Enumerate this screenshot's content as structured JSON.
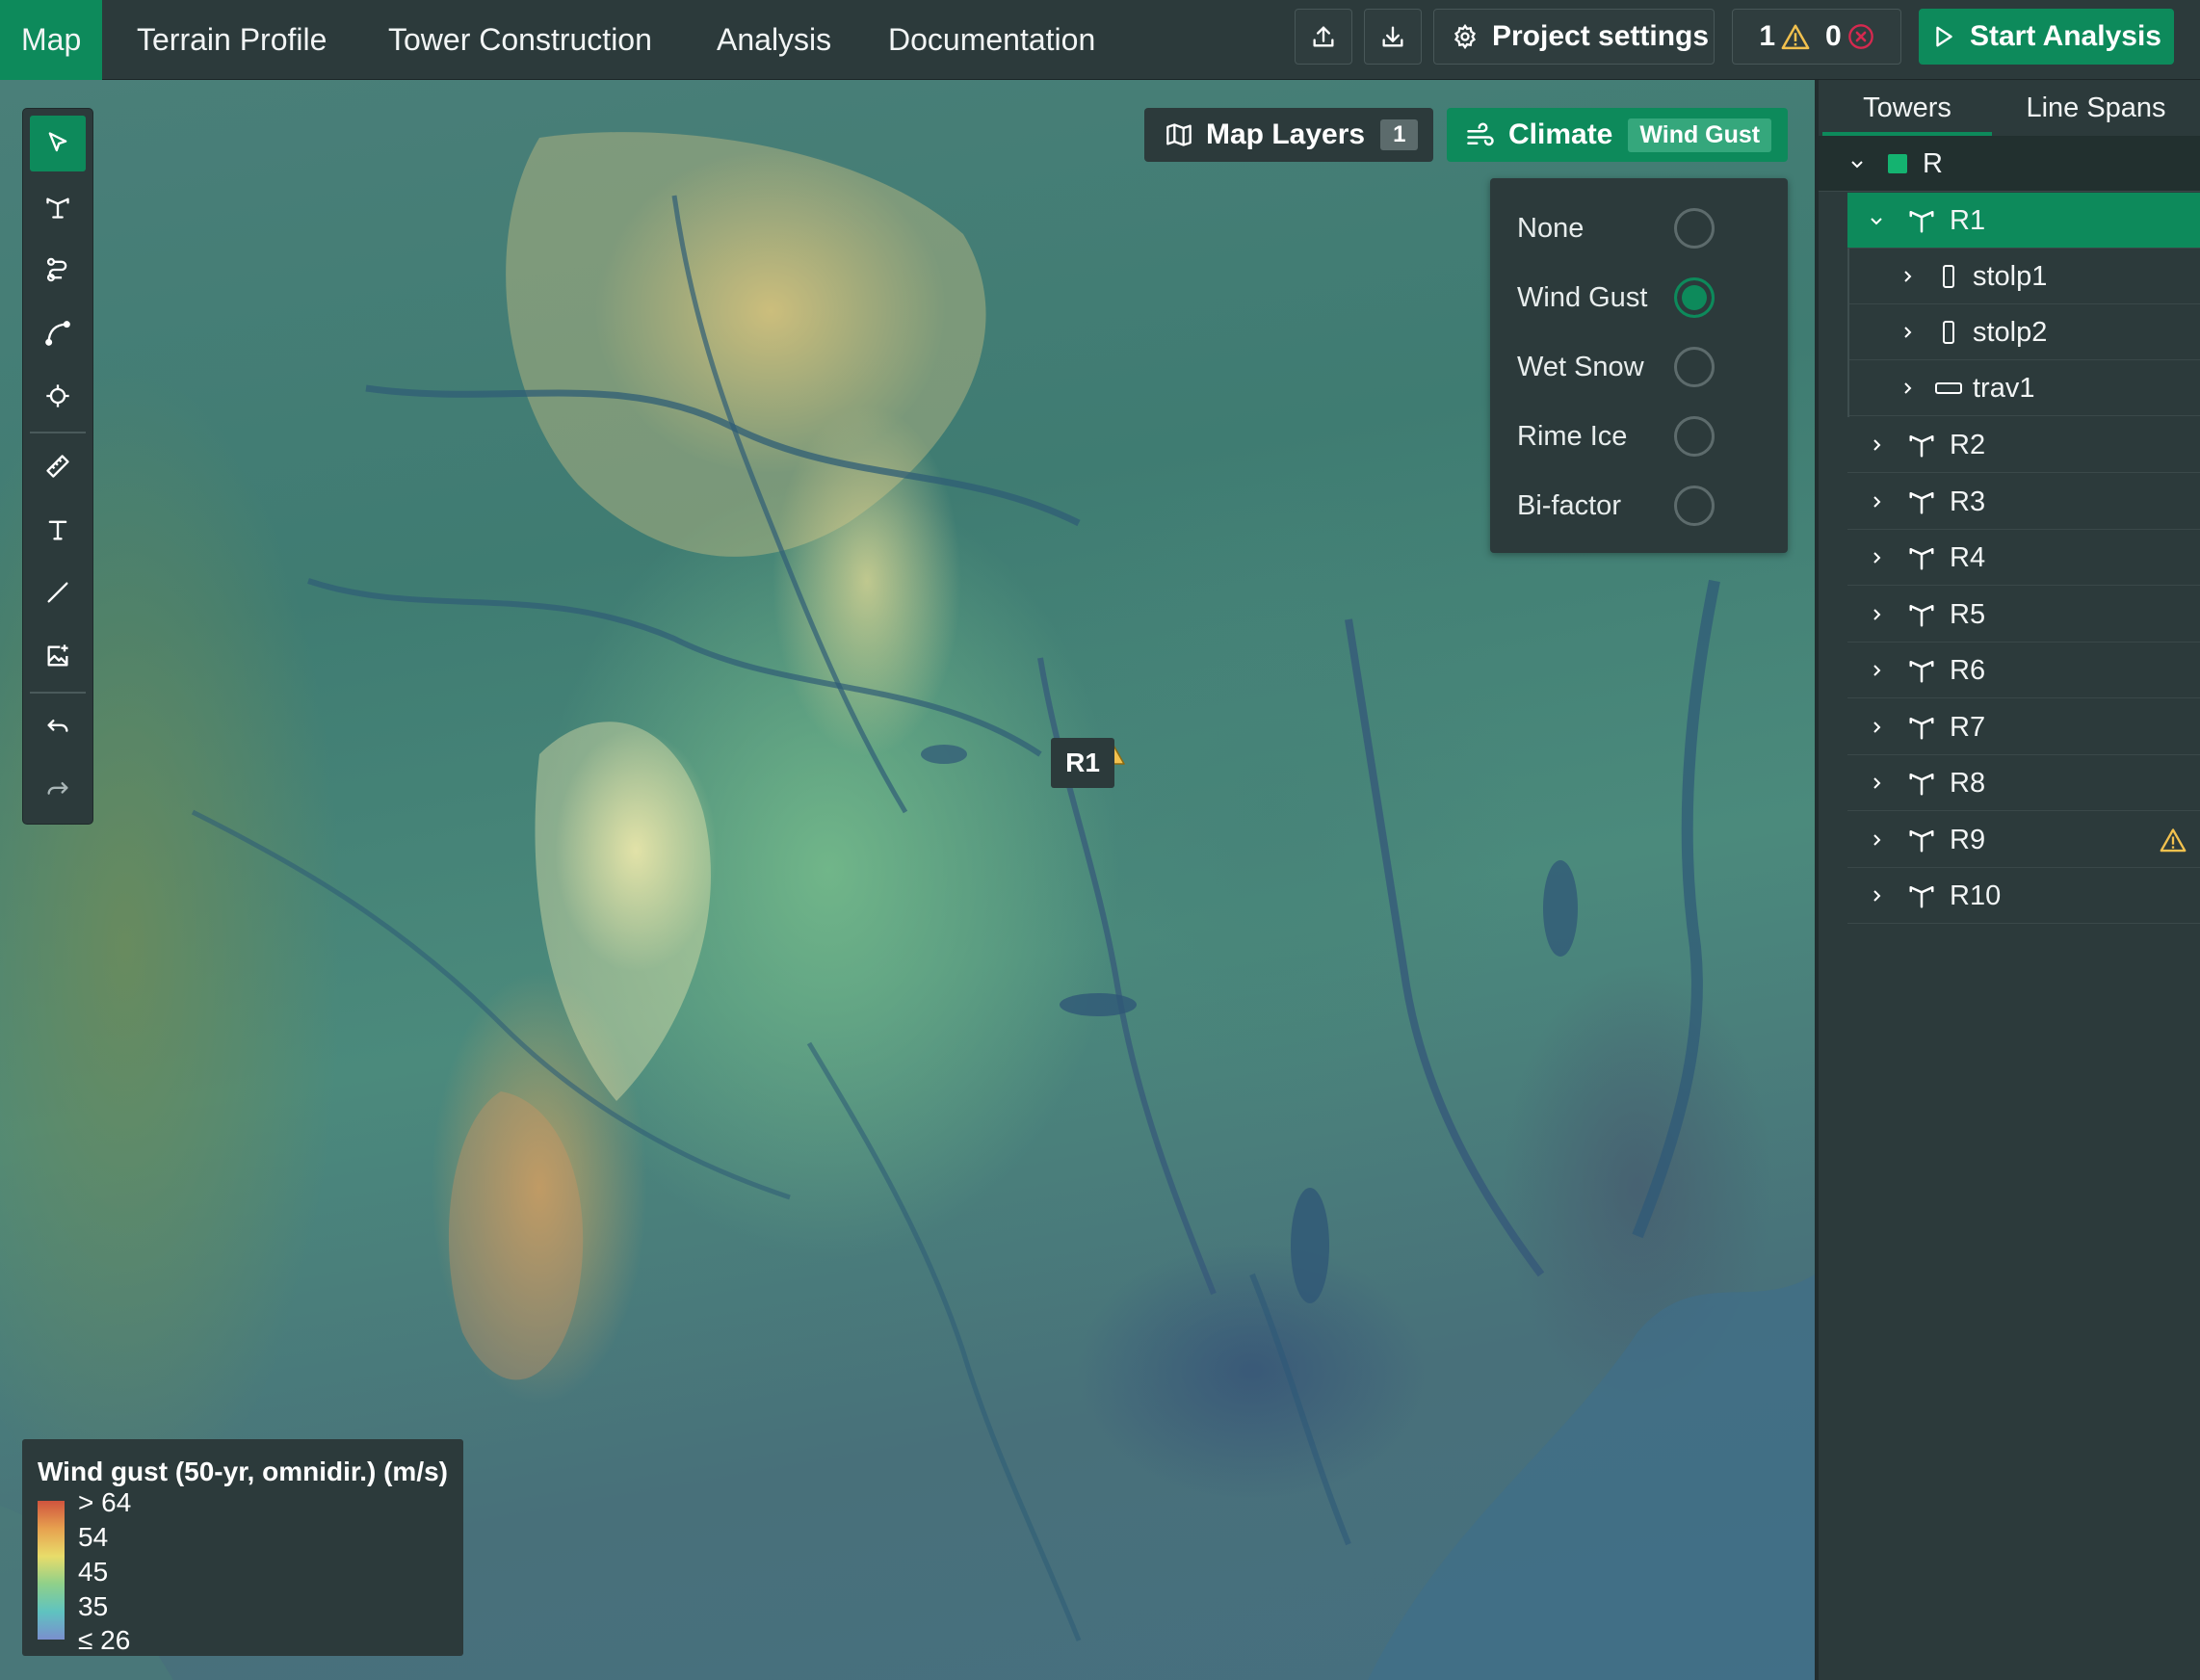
{
  "nav": {
    "tabs": [
      {
        "label": "Map",
        "active": true
      },
      {
        "label": "Terrain Profile"
      },
      {
        "label": "Tower Construction"
      },
      {
        "label": "Analysis"
      },
      {
        "label": "Documentation"
      }
    ]
  },
  "toolbar": {
    "upload_icon": "upload-icon",
    "download_icon": "download-icon",
    "project_settings_label": "Project settings",
    "warning_count": "1",
    "error_count": "0",
    "start_label": "Start Analysis"
  },
  "map": {
    "layers_label": "Map Layers",
    "layers_count": "1",
    "climate_label": "Climate",
    "climate_selected": "Wind Gust",
    "climate_options": [
      {
        "label": "None",
        "selected": false
      },
      {
        "label": "Wind Gust",
        "selected": true
      },
      {
        "label": "Wet Snow",
        "selected": false
      },
      {
        "label": "Rime Ice",
        "selected": false
      },
      {
        "label": "Bi-factor",
        "selected": false
      }
    ],
    "tower_marker_label": "R1",
    "tools": [
      "select-icon",
      "tower-icon",
      "route-icon",
      "curve-icon",
      "target-icon",
      "ruler-icon",
      "text-icon",
      "line-icon",
      "image-add-icon",
      "undo-icon",
      "redo-icon"
    ]
  },
  "legend": {
    "title": "Wind gust (50-yr, omnidir.) (m/s)",
    "labels": [
      "> 64",
      "54",
      "45",
      "35",
      "≤ 26"
    ],
    "colors": [
      "#d0543e",
      "#e7a14f",
      "#e8dc6a",
      "#8fd08a",
      "#5fc3c0",
      "#7a8fce"
    ]
  },
  "panel": {
    "tabs": [
      {
        "label": "Towers",
        "active": true
      },
      {
        "label": "Line Spans"
      }
    ],
    "group": {
      "label": "R",
      "color": "#14b370"
    },
    "selected_tower": {
      "label": "R1",
      "children": [
        {
          "label": "stolp1",
          "icon": "pole-icon"
        },
        {
          "label": "stolp2",
          "icon": "pole-icon"
        },
        {
          "label": "trav1",
          "icon": "crossarm-icon"
        }
      ]
    },
    "towers": [
      {
        "label": "R2"
      },
      {
        "label": "R3"
      },
      {
        "label": "R4"
      },
      {
        "label": "R5"
      },
      {
        "label": "R6"
      },
      {
        "label": "R7"
      },
      {
        "label": "R8"
      },
      {
        "label": "R9",
        "warning": true
      },
      {
        "label": "R10"
      }
    ]
  },
  "colors": {
    "accent": "#0d8a5b",
    "warning": "#f2c14e",
    "error": "#d6294f",
    "marker": "#d11e5e"
  }
}
